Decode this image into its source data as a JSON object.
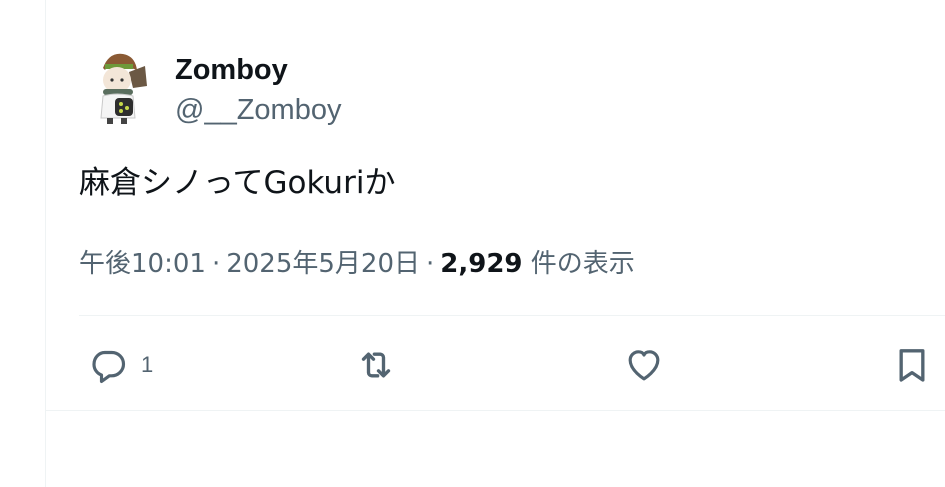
{
  "author": {
    "name": "Zomboy",
    "handle": "@__Zomboy"
  },
  "tweet": {
    "text": "麻倉シノってGokuriか"
  },
  "meta": {
    "time": "午後10:01",
    "separator": "·",
    "date": "2025年5月20日",
    "views_count": "2,929",
    "views_label": "件の表示"
  },
  "actions": {
    "reply_count": "1"
  },
  "icons": {
    "reply": "reply-icon",
    "repost": "repost-icon",
    "like": "heart-icon",
    "bookmark": "bookmark-icon"
  },
  "colors": {
    "text_primary": "#0f1419",
    "text_secondary": "#536471",
    "divider": "#eff3f4"
  }
}
